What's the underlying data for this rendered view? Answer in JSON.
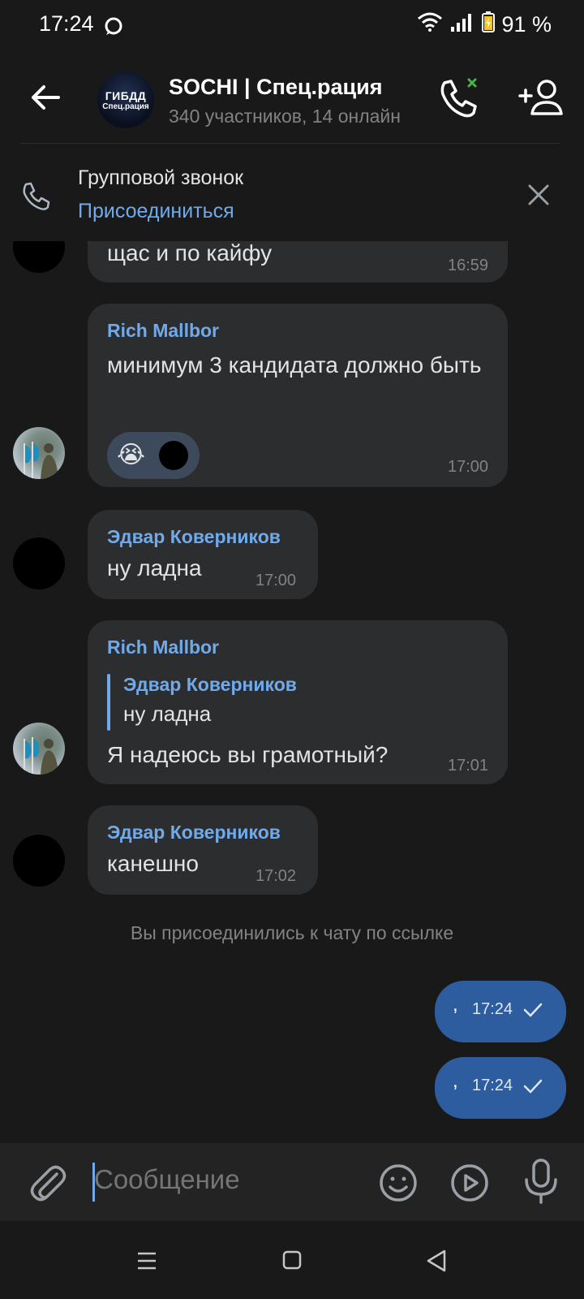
{
  "status_bar": {
    "time": "17:24",
    "battery": "91 %"
  },
  "header": {
    "avatar_line1": "ГИБДД",
    "avatar_line2": "Спец.рация",
    "title": "SOCHI | Спец.рация",
    "subtitle": "340 участников, 14 онлайн"
  },
  "call_banner": {
    "title": "Групповой звонок",
    "join": "Присоединиться"
  },
  "messages": [
    {
      "text": "щас и по кайфу",
      "time": "16:59"
    },
    {
      "sender": "Rich Mallbor",
      "text": "минимум 3 кандидата должно быть",
      "time": "17:00",
      "reactions": [
        "😭",
        "●"
      ]
    },
    {
      "sender": "Эдвар Коверников",
      "text": "ну ладна",
      "time": "17:00"
    },
    {
      "sender": "Rich Mallbor",
      "reply_to": {
        "sender": "Эдвар Коверников",
        "text": "ну ладна"
      },
      "text": "Я надеюсь вы грамотный?",
      "time": "17:01"
    },
    {
      "sender": "Эдвар Коверников",
      "text": "канешно",
      "time": "17:02"
    }
  ],
  "service_message": "Вы присоединились к чату по ссылке",
  "my_messages": [
    {
      "text": ",",
      "time": "17:24"
    },
    {
      "text": ",",
      "time": "17:24"
    }
  ],
  "composer": {
    "placeholder": "Сообщение"
  },
  "colors": {
    "background": "#191919",
    "bubble": "#2c2d2e",
    "accent": "#71aaeb",
    "outgoing": "#2d5d9e"
  }
}
